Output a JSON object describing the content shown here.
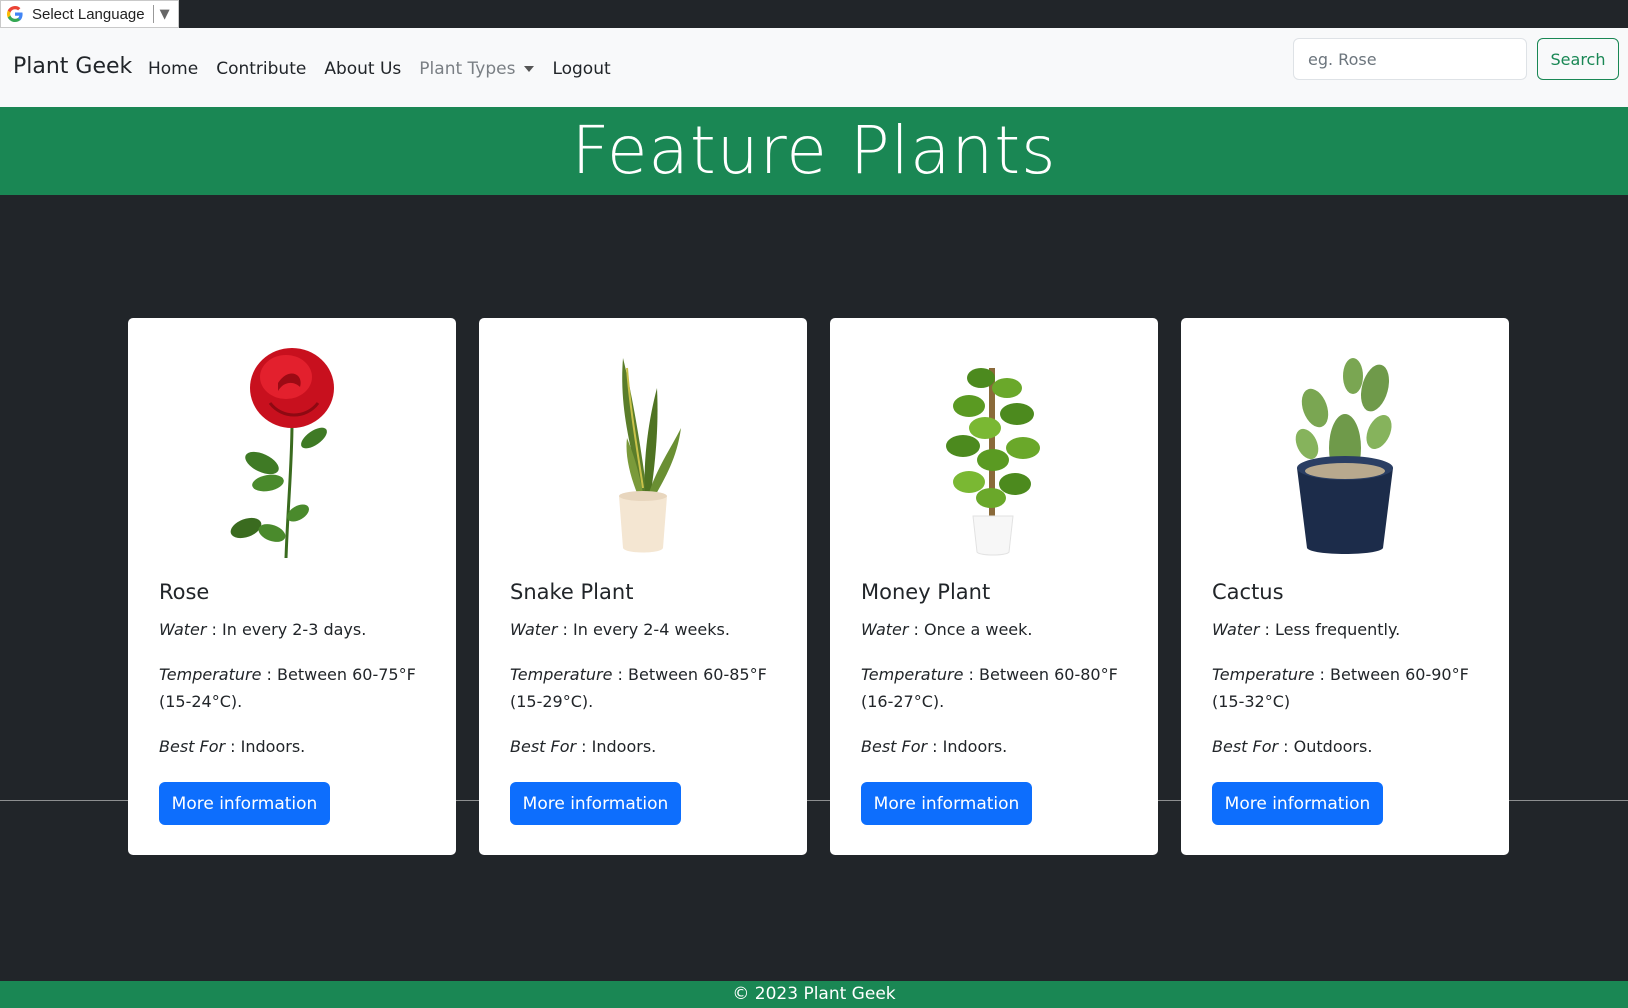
{
  "translate": {
    "label": "Select Language",
    "arrow": "▼",
    "icon": "google-g-icon"
  },
  "navbar": {
    "brand": "Plant Geek",
    "links": [
      "Home",
      "Contribute",
      "About Us",
      "Plant Types",
      "Logout"
    ],
    "search_placeholder": "eg. Rose",
    "search_label": "Search"
  },
  "hero": {
    "title": "Feature Plants"
  },
  "cards": [
    {
      "title": "Rose",
      "water_key": "Water",
      "water": " : In every 2-3 days.",
      "temp_key": "Temperature",
      "temp": " : Between 60-75°F (15-24°C).",
      "best_key": "Best For",
      "best": " : Indoors.",
      "button": "More information",
      "image": "rose-image"
    },
    {
      "title": "Snake Plant",
      "water_key": "Water",
      "water": " : In every 2-4 weeks.",
      "temp_key": "Temperature",
      "temp": " : Between 60-85°F (15-29°C).",
      "best_key": "Best For",
      "best": " : Indoors.",
      "button": "More information",
      "image": "snake-plant-image"
    },
    {
      "title": "Money Plant",
      "water_key": "Water",
      "water": " : Once a week.",
      "temp_key": "Temperature",
      "temp": " : Between 60-80°F (16-27°C).",
      "best_key": "Best For",
      "best": " : Indoors.",
      "button": "More information",
      "image": "money-plant-image"
    },
    {
      "title": "Cactus",
      "water_key": "Water",
      "water": " : Less frequently.",
      "temp_key": "Temperature",
      "temp": " : Between 60-90°F (15-32°C)",
      "best_key": "Best For",
      "best": " : Outdoors.",
      "button": "More information",
      "image": "cactus-image"
    }
  ],
  "footer": {
    "text": "© 2023 Plant Geek"
  },
  "colors": {
    "green": "#1a8754",
    "primary": "#0d6efd",
    "dark": "#212529",
    "navbar": "#f8f9fa"
  }
}
